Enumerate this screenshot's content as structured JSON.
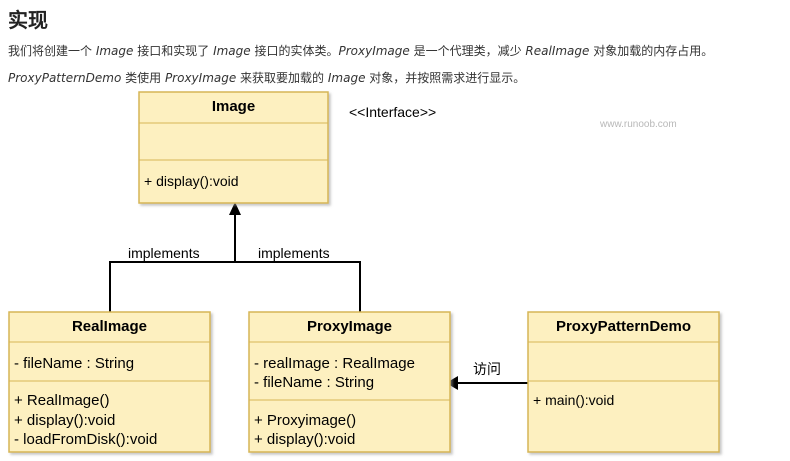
{
  "heading": "实现",
  "paragraphs": [
    [
      {
        "t": "我们将创建一个 ",
        "i": false
      },
      {
        "t": "Image",
        "i": true
      },
      {
        "t": " 接口和实现了 ",
        "i": false
      },
      {
        "t": "Image",
        "i": true
      },
      {
        "t": " 接口的实体类。",
        "i": false
      },
      {
        "t": "ProxyImage",
        "i": true
      },
      {
        "t": " 是一个代理类，减少 ",
        "i": false
      },
      {
        "t": "RealImage",
        "i": true
      },
      {
        "t": " 对象加载的内存占用。",
        "i": false
      }
    ],
    [
      {
        "t": "ProxyPatternDemo",
        "i": true
      },
      {
        "t": " 类使用 ",
        "i": false
      },
      {
        "t": "ProxyImage",
        "i": true
      },
      {
        "t": " 来获取要加载的 ",
        "i": false
      },
      {
        "t": "Image",
        "i": true
      },
      {
        "t": " 对象，并按照需求进行显示。",
        "i": false
      }
    ]
  ],
  "watermark": "www.runoob.com",
  "interface_stereotype": "<<Interface>>",
  "colors": {
    "box_fill": "#fdf0c0",
    "box_border": "#d6b656",
    "line": "#000000"
  },
  "classes": {
    "image": {
      "name": "Image",
      "attributes": [],
      "methods": [
        "+ display():void"
      ]
    },
    "realimage": {
      "name": "RealImage",
      "attributes": [
        "- fileName : String"
      ],
      "methods": [
        "+ RealImage()",
        "+ display():void",
        "- loadFromDisk():void"
      ]
    },
    "proxyimage": {
      "name": "ProxyImage",
      "attributes": [
        "- realImage : RealImage",
        "- fileName : String"
      ],
      "methods": [
        "+ Proxyimage()",
        "+ display():void"
      ]
    },
    "demo": {
      "name": "ProxyPatternDemo",
      "attributes": [],
      "methods": [
        "+ main():void"
      ]
    }
  },
  "relations": {
    "implements_left": "implements",
    "implements_right": "implements",
    "uses": "访问"
  }
}
